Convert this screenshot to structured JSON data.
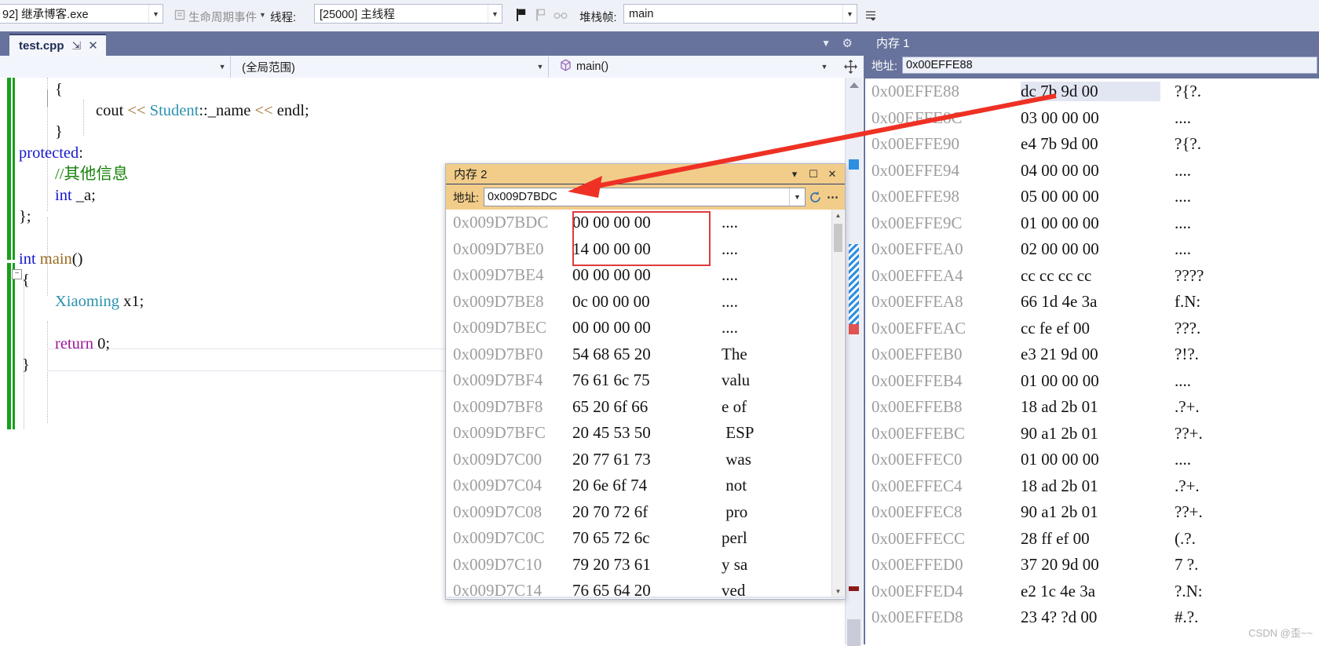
{
  "toolbar": {
    "process": "92] 继承博客.exe",
    "lifecycle_events": "生命周期事件",
    "thread_label": "线程:",
    "thread_value": "[25000] 主线程",
    "stackframe_label": "堆栈帧:",
    "stackframe_value": "main",
    "icons": {
      "lifecycle_icon": "lifecycle-icon",
      "flag_icon": "flag-icon",
      "threads_icon": "threads-icon",
      "link_icon": "link-icon",
      "overflow_icon": "overflow-icon"
    }
  },
  "editor": {
    "tab_name": "test.cpp",
    "scope_combo": "",
    "global_scope": "(全局范围)",
    "member_combo": "main()",
    "code_lines": [
      {
        "indent": 70,
        "tokens": [
          {
            "t": "{",
            "c": "k-plain"
          }
        ]
      },
      {
        "indent": 122,
        "tokens": [
          {
            "t": "cout ",
            "c": "k-plain"
          },
          {
            "t": "<< ",
            "c": "k-op"
          },
          {
            "t": "Student",
            "c": "k-type"
          },
          {
            "t": "::_name ",
            "c": "k-plain"
          },
          {
            "t": "<< ",
            "c": "k-op"
          },
          {
            "t": "endl",
            "c": "k-plain"
          },
          {
            "t": ";",
            "c": "k-plain"
          }
        ]
      },
      {
        "indent": 70,
        "tokens": [
          {
            "t": "}",
            "c": "k-plain"
          }
        ]
      },
      {
        "indent": 24,
        "tokens": [
          {
            "t": "protected",
            "c": "k-blue"
          },
          {
            "t": ":",
            "c": "k-plain"
          }
        ]
      },
      {
        "indent": 70,
        "tokens": [
          {
            "t": "//其他信息",
            "c": "k-cmt"
          }
        ]
      },
      {
        "indent": 70,
        "tokens": [
          {
            "t": "int",
            "c": "k-blue"
          },
          {
            "t": " _a;",
            "c": "k-plain"
          }
        ]
      },
      {
        "indent": 24,
        "tokens": [
          {
            "t": "};",
            "c": "k-plain"
          }
        ]
      },
      {
        "indent": 24,
        "tokens": [
          {
            "t": "",
            "c": "k-plain"
          }
        ]
      },
      {
        "indent": 24,
        "tokens": [
          {
            "t": "int",
            "c": "k-blue"
          },
          {
            "t": " ",
            "c": "k-plain"
          },
          {
            "t": "main",
            "c": "k-op"
          },
          {
            "t": "()",
            "c": "k-plain"
          }
        ]
      },
      {
        "indent": 28,
        "tokens": [
          {
            "t": "{",
            "c": "k-plain"
          }
        ]
      },
      {
        "indent": 70,
        "tokens": [
          {
            "t": "Xiaoming",
            "c": "k-type"
          },
          {
            "t": " x1;",
            "c": "k-plain"
          }
        ]
      },
      {
        "indent": 70,
        "tokens": [
          {
            "t": "",
            "c": "k-plain"
          }
        ]
      },
      {
        "indent": 70,
        "tokens": [
          {
            "t": "return",
            "c": "k-pur"
          },
          {
            "t": " 0;",
            "c": "k-plain"
          }
        ]
      },
      {
        "indent": 28,
        "tokens": [
          {
            "t": "}",
            "c": "k-plain"
          }
        ]
      }
    ]
  },
  "memory1": {
    "title": "内存 1",
    "address_label": "地址:",
    "address_value": "0x00EFFE88",
    "rows": [
      {
        "addr": "0x00EFFE88",
        "hex": "dc 7b 9d 00",
        "ascii": "?{?.",
        "selected": true
      },
      {
        "addr": "0x00EFFE8C",
        "hex": "03 00 00 00",
        "ascii": "....",
        "selected": false
      },
      {
        "addr": "0x00EFFE90",
        "hex": "e4 7b 9d 00",
        "ascii": "?{?.",
        "selected": false
      },
      {
        "addr": "0x00EFFE94",
        "hex": "04 00 00 00",
        "ascii": "....",
        "selected": false
      },
      {
        "addr": "0x00EFFE98",
        "hex": "05 00 00 00",
        "ascii": "....",
        "selected": false
      },
      {
        "addr": "0x00EFFE9C",
        "hex": "01 00 00 00",
        "ascii": "....",
        "selected": false
      },
      {
        "addr": "0x00EFFEA0",
        "hex": "02 00 00 00",
        "ascii": "....",
        "selected": false
      },
      {
        "addr": "0x00EFFEA4",
        "hex": "cc cc cc cc",
        "ascii": "????",
        "selected": false
      },
      {
        "addr": "0x00EFFEA8",
        "hex": "66 1d 4e 3a",
        "ascii": "f.N:",
        "selected": false
      },
      {
        "addr": "0x00EFFEAC",
        "hex": "cc fe ef 00",
        "ascii": "???.",
        "selected": false
      },
      {
        "addr": "0x00EFFEB0",
        "hex": "e3 21 9d 00",
        "ascii": "?!?.",
        "selected": false
      },
      {
        "addr": "0x00EFFEB4",
        "hex": "01 00 00 00",
        "ascii": "....",
        "selected": false
      },
      {
        "addr": "0x00EFFEB8",
        "hex": "18 ad 2b 01",
        "ascii": ".?+.",
        "selected": false
      },
      {
        "addr": "0x00EFFEBC",
        "hex": "90 a1 2b 01",
        "ascii": "??+.",
        "selected": false
      },
      {
        "addr": "0x00EFFEC0",
        "hex": "01 00 00 00",
        "ascii": "....",
        "selected": false
      },
      {
        "addr": "0x00EFFEC4",
        "hex": "18 ad 2b 01",
        "ascii": ".?+.",
        "selected": false
      },
      {
        "addr": "0x00EFFEC8",
        "hex": "90 a1 2b 01",
        "ascii": "??+.",
        "selected": false
      },
      {
        "addr": "0x00EFFECC",
        "hex": "28 ff ef 00",
        "ascii": "(.?.",
        "selected": false
      },
      {
        "addr": "0x00EFFED0",
        "hex": "37 20 9d 00",
        "ascii": "7 ?.",
        "selected": false
      },
      {
        "addr": "0x00EFFED4",
        "hex": "e2 1c 4e 3a",
        "ascii": "?.N:",
        "selected": false
      },
      {
        "addr": "0x00EFFED8",
        "hex": "23 4? ?d 00",
        "ascii": "#.?.",
        "selected": false
      }
    ]
  },
  "memory2": {
    "title": "内存 2",
    "address_label": "地址:",
    "address_value": "0x009D7BDC",
    "buttons": {
      "dropdown": "▾",
      "maximize": "☐",
      "close": "✕",
      "refresh": "refresh-icon",
      "overflow": "⋯"
    },
    "rows": [
      {
        "addr": "0x009D7BDC",
        "hex": "00 00 00 00",
        "ascii": "...."
      },
      {
        "addr": "0x009D7BE0",
        "hex": "14 00 00 00",
        "ascii": "...."
      },
      {
        "addr": "0x009D7BE4",
        "hex": "00 00 00 00",
        "ascii": "...."
      },
      {
        "addr": "0x009D7BE8",
        "hex": "0c 00 00 00",
        "ascii": "...."
      },
      {
        "addr": "0x009D7BEC",
        "hex": "00 00 00 00",
        "ascii": "...."
      },
      {
        "addr": "0x009D7BF0",
        "hex": "54 68 65 20",
        "ascii": "The "
      },
      {
        "addr": "0x009D7BF4",
        "hex": "76 61 6c 75",
        "ascii": "valu"
      },
      {
        "addr": "0x009D7BF8",
        "hex": "65 20 6f 66",
        "ascii": "e of"
      },
      {
        "addr": "0x009D7BFC",
        "hex": "20 45 53 50",
        "ascii": " ESP"
      },
      {
        "addr": "0x009D7C00",
        "hex": "20 77 61 73",
        "ascii": " was"
      },
      {
        "addr": "0x009D7C04",
        "hex": "20 6e 6f 74",
        "ascii": " not"
      },
      {
        "addr": "0x009D7C08",
        "hex": "20 70 72 6f",
        "ascii": " pro"
      },
      {
        "addr": "0x009D7C0C",
        "hex": "70 65 72 6c",
        "ascii": "perl"
      },
      {
        "addr": "0x009D7C10",
        "hex": "79 20 73 61",
        "ascii": "y sa"
      },
      {
        "addr": "0x009D7C14",
        "hex": "76 65 64 20",
        "ascii": "ved "
      }
    ]
  },
  "watermark": "CSDN @歪~~",
  "colors": {
    "chrome_blue": "#67739c",
    "float_title": "#f2cd8a",
    "annotation_red": "#ee3124",
    "breakpoint_green": "#17a01b"
  }
}
